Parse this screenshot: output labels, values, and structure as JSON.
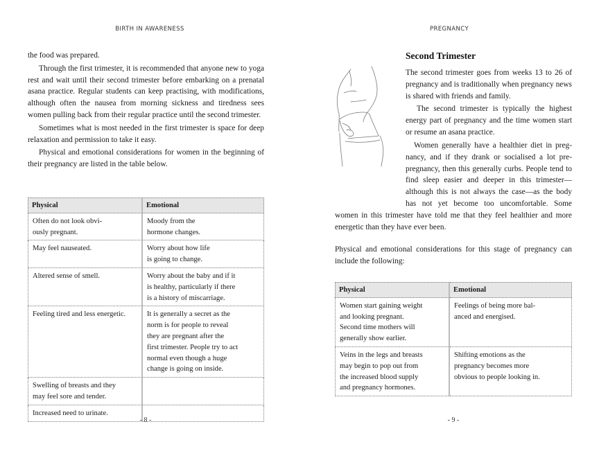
{
  "left_page": {
    "running_head": "BIRTH IN AWARENESS",
    "paragraphs": [
      "the food was prepared.",
      "Through the first trimester, it is recommended that anyone new to yoga rest and wait until their second trimester before embarking on a prenatal asana practice. Regular students can keep practising, with modifications, although often the nausea from morning sickness and tiredness sees women pulling back from their regular practice until the second trimester.",
      "Sometimes what is most needed in the first trimester is space for deep relaxation and permission to take it easy.",
      "Physical and emotional considerations for women in the beginning of their pregnancy are listed in the table below."
    ],
    "table": {
      "headers": [
        "Physical",
        "Emotional"
      ],
      "rows": [
        [
          "Often do not look obvi-\nously pregnant.",
          "Moody from the\nhormone changes."
        ],
        [
          "May feel nauseated.",
          "Worry about how life\nis going to change."
        ],
        [
          "Altered sense of smell.",
          "Worry about the baby and if it\nis healthy, particularly if there\nis a history of miscarriage."
        ],
        [
          "Feeling tired and less energetic.",
          "It is generally a secret as the\nnorm is for people to reveal\nthey are pregnant after the\nfirst trimester. People try to act\nnormal even though a huge\nchange is going on inside."
        ],
        [
          "Swelling of breasts and they\nmay feel sore and tender.",
          ""
        ],
        [
          "Increased need to urinate.",
          ""
        ]
      ]
    },
    "folio": "- 8 -"
  },
  "right_page": {
    "running_head": "PREGNANCY",
    "section_title": "Second Trimester",
    "illustration": "pregnant-woman-side-profile-sketch",
    "paragraphs": [
      "The second trimester goes from weeks 13 to 26 of pregnancy and is traditionally when pregnancy news is shared with friends and family.",
      "The second trimester is typically the highest energy part of pregnancy and the time women start or resume an asana practice.",
      "Women generally have a healthier diet in preg-nancy, and if they drank or socialised a lot pre-pregnancy, then this generally curbs. People tend to find sleep easier and deeper in this trimester—although this is not always the case—as the body has not yet become too uncomfortable. Some women in this trimester have told me that they feel healthier and more energetic than they have ever been.",
      "Physical and emotional considerations for this stage of pregnancy can include the following:"
    ],
    "table": {
      "headers": [
        "Physical",
        "Emotional"
      ],
      "rows": [
        [
          "Women start gaining weight\nand looking pregnant.\nSecond time mothers will\ngenerally show earlier.",
          "Feelings of being more bal-\nanced and energised."
        ],
        [
          "Veins in the legs and breasts\nmay begin to pop out from\nthe increased blood supply\nand pregnancy hormones.",
          "Shifting emotions as the\npregnancy becomes more\nobvious to people looking in."
        ]
      ]
    },
    "folio": "- 9 -"
  }
}
